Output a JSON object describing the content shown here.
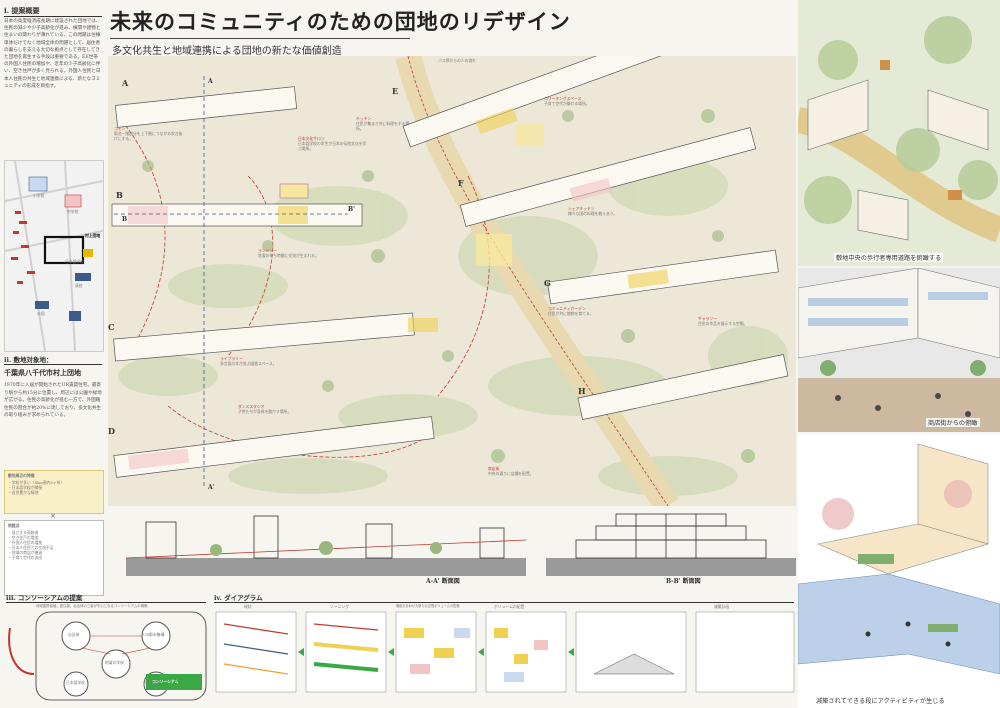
{
  "title": "未来のコミュニティのための団地のリデザイン",
  "subtitle": "多文化共生と地域連携による団地の新たな価値創造",
  "sections": {
    "proposal_overview": "i. 提案概要",
    "site": "ii. 敷地対象地：",
    "site_name": "千葉県八千代市村上団地",
    "consortium": "iii. コンソーシアムの提案",
    "diagram": "iv. ダイアグラム"
  },
  "overview_text": "日本の高度経済成長期に建設された団地では、住民の減少や少子高齢化が進み、棟間や建物と住まいの関わりが薄れている。この問題は住棟単体だけでなく地域全体の問題として、居住者の暮らしを支える大切な拠点として存在してきた団地を再生する手段は重要である。EE世帯の外国人住民の増加や、近年の少子高齢化に伴い、空き住戸が多く見られる。外国人住民と日本人住民の共生と地域連携による、新たなコミュニティの形成を目指す。",
  "site_text": "1970年に入居が開始されたUR賃貸住宅。最寄り駅から約15分に位置し、周辺には公園や緑地が広がる。住民の高齢化が進む一方で、外国籍住民の割合が約20%に達しており、多文化共生の取り組みが求められている。",
  "legend_title": "敷地周辺の特徴",
  "legend_items": [
    "・学校が多い（4km圏内5ヶ所）",
    "・日本語学校が隣接",
    "・自然豊かな緑地"
  ],
  "issues_title": "問題点",
  "issues_items": [
    "・孤立する高齢者",
    "・空き住戸の増加",
    "・外国人住民の増加",
    "・日本人住民との交流不足",
    "・地域の商店が撤退",
    "・子育て世代の流出"
  ],
  "consortium_header": "地域連携協議、居住者、自治体の三者が中心となるコンソーシアムの構築",
  "consortium_nodes": [
    "自治体",
    "UR都市機構",
    "地域の学校",
    "日本語学校",
    "地域住民"
  ],
  "consortium_badge": "コンソーシアム",
  "diagram_steps": [
    "現状",
    "ゾーニング",
    "機能をあわせた新たな空間ボリュームの配置",
    "ボリュームの配置",
    "減築計画"
  ],
  "map_labels": [
    "小学校",
    "中学校",
    "高校",
    "日本語学校",
    "公園",
    "村上団地"
  ],
  "plan": {
    "building_labels": [
      "A",
      "B",
      "C",
      "D",
      "E",
      "F",
      "G",
      "H"
    ],
    "section_markers": [
      "A",
      "A'",
      "B",
      "B'"
    ],
    "notes": [
      {
        "title": "コモン",
        "text": "東北一階部分を上下階につながる吹き抜けにする。"
      },
      {
        "title": "日本文化サロン",
        "text": "日本語学校の学生が日本の伝統文化を学ぶ場所。"
      },
      {
        "title": "キッチン",
        "text": "住民が集まり共に料理をする場所。"
      },
      {
        "title": "コワーキングスペース",
        "text": "子育て世代が働ける場所。"
      },
      {
        "title": "ランドリー",
        "text": "洗濯の待ち時間に交流が生まれる。"
      },
      {
        "title": "ライブラリー",
        "text": "多言語の本が並ぶ図書スペース。"
      },
      {
        "title": "ダンススタジオ",
        "text": "子供たちが身体を動かす場所。"
      },
      {
        "title": "シェアキッチン",
        "text": "様々な国の料理を教えあう。"
      },
      {
        "title": "コミュニティガーデン",
        "text": "住民が共に植物を育てる。"
      },
      {
        "title": "ギャラリー",
        "text": "住民の作品を展示する空間。"
      },
      {
        "title": "商店街",
        "text": "中央の通りに店舗を配置。"
      }
    ],
    "path_label": "バス停からの人の流れ"
  },
  "sections_drawing": {
    "aa_label": "A-A' 断面図",
    "bb_label": "B-B' 断面図"
  },
  "perspectives": {
    "caption1": "敷地中央の歩行者専用道路を俯瞰する",
    "caption2": "商店街からの俯瞰",
    "caption3": "減築されてできる段にアクティビティが生じる"
  },
  "colors": {
    "accent_red": "#c0392b",
    "accent_yellow": "#f0d050",
    "accent_blue": "#3b5b8a",
    "green": "#7fae6f"
  }
}
